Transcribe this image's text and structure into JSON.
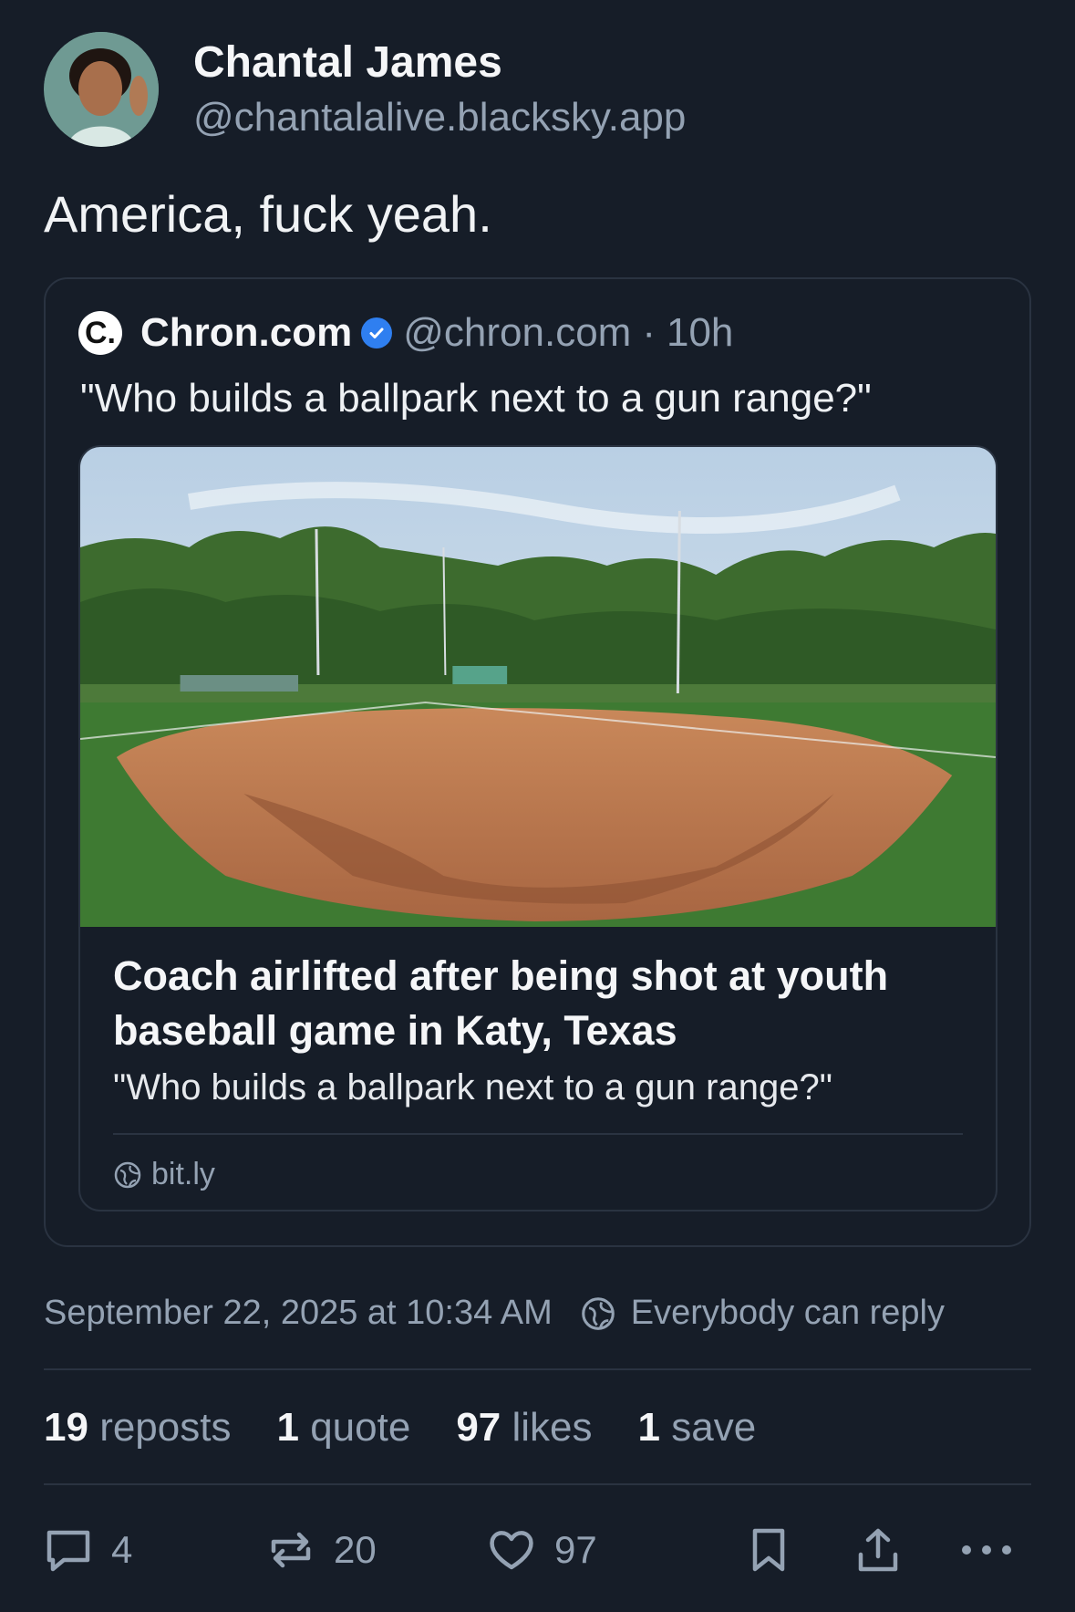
{
  "author": {
    "name": "Chantal James",
    "handle": "@chantalalive.blacksky.app"
  },
  "post": {
    "text": "America, fuck yeah."
  },
  "quoted_post": {
    "logo_letter": "C.",
    "name": "Chron.com",
    "handle": "@chron.com",
    "separator": "·",
    "age": "10h",
    "text": "\"Who builds a ballpark next to a gun range?\"",
    "link_card": {
      "title": "Coach airlifted after being shot at youth baseball game in Katy, Texas",
      "description": "\"Who builds a ballpark next to a gun range?\"",
      "domain": "bit.ly"
    }
  },
  "meta": {
    "timestamp": "September 22, 2025 at 10:34 AM",
    "reply_setting": "Everybody can reply"
  },
  "stats": {
    "reposts_count": "19",
    "reposts_label": "reposts",
    "quotes_count": "1",
    "quotes_label": "quote",
    "likes_count": "97",
    "likes_label": "likes",
    "saves_count": "1",
    "saves_label": "save"
  },
  "actions": {
    "reply_count": "4",
    "repost_count": "20",
    "like_count": "97"
  },
  "colors": {
    "background": "#161d28",
    "muted_text": "#94a2b3",
    "border": "#2a3341",
    "verified": "#2f7ff0"
  }
}
